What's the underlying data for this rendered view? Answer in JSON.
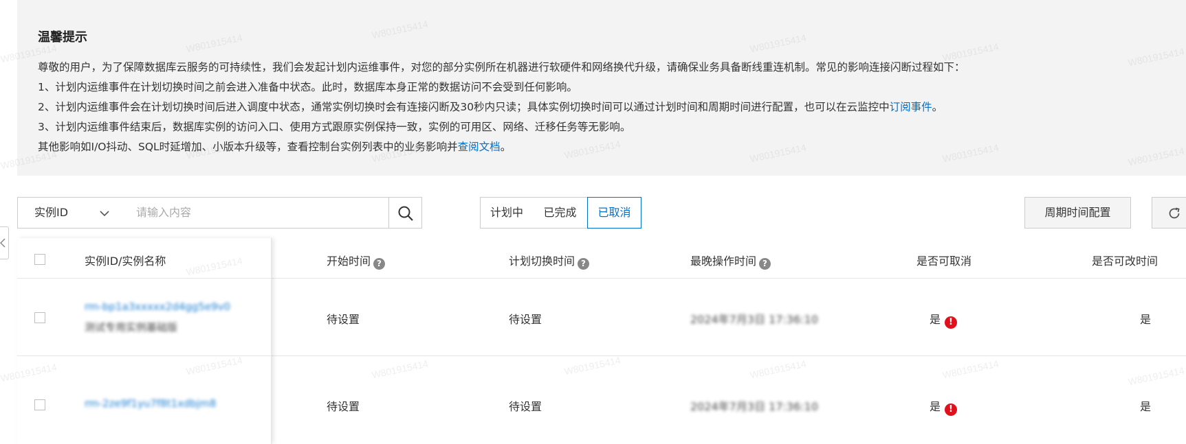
{
  "notice": {
    "title": "温馨提示",
    "lines": [
      "尊敬的用户，为了保障数据库云服务的可持续性，我们会发起计划内运维事件，对您的部分实例所在机器进行软硬件和网络换代升级，请确保业务具备断线重连机制。常见的影响连接闪断过程如下：",
      "1、计划内运维事件在计划切换时间之前会进入准备中状态。此时，数据库本身正常的数据访问不会受到任何影响。",
      "2、计划内运维事件会在计划切换时间后进入调度中状态，通常实例切换时会有连接闪断及30秒内只读；具体实例切换时间可以通过计划时间和周期时间进行配置，也可以在云监控中",
      "3、计划内运维事件结束后，数据库实例的访问入口、使用方式跟原实例保持一致，实例的可用区、网络、迁移任务等无影响。",
      "其他影响如I/O抖动、SQL时延增加、小版本升级等，查看控制台实例列表中的业务影响并"
    ],
    "subscribe_link": "订阅事件",
    "subscribe_suffix": "。",
    "docs_link": "查阅文档",
    "docs_suffix": "。"
  },
  "watermark": "W801915414",
  "search": {
    "field": "实例ID",
    "placeholder": "请输入内容"
  },
  "status_tabs": [
    {
      "label": "计划中",
      "active": false
    },
    {
      "label": "已完成",
      "active": false
    },
    {
      "label": "已取消",
      "active": true
    }
  ],
  "toolbar": {
    "period_config": "周期时间配置"
  },
  "table": {
    "headers": [
      "实例ID/实例名称",
      "开始时间",
      "计划切换时间",
      "最晚操作时间",
      "是否可取消",
      "是否可改时间"
    ],
    "rows": [
      {
        "instance_id": "rm-bp1a3xxxxx2d4gg5e9v0",
        "instance_name": "测试专用实例基础版",
        "start_time": "待设置",
        "switch_time": "待设置",
        "latest_op_time": "2024年7月3日 17:36:10",
        "cancellable": "是",
        "changeable": "是"
      },
      {
        "instance_id": "rm-2ze9f1yu7f8t1xdbjm8",
        "instance_name": "",
        "start_time": "待设置",
        "switch_time": "待设置",
        "latest_op_time": "2024年7月3日 17:36:10",
        "cancellable": "是",
        "changeable": "是"
      }
    ]
  },
  "colors": {
    "accent": "#0070cc",
    "warn": "#e0101c",
    "notice_bg": "#f3f3f3"
  }
}
